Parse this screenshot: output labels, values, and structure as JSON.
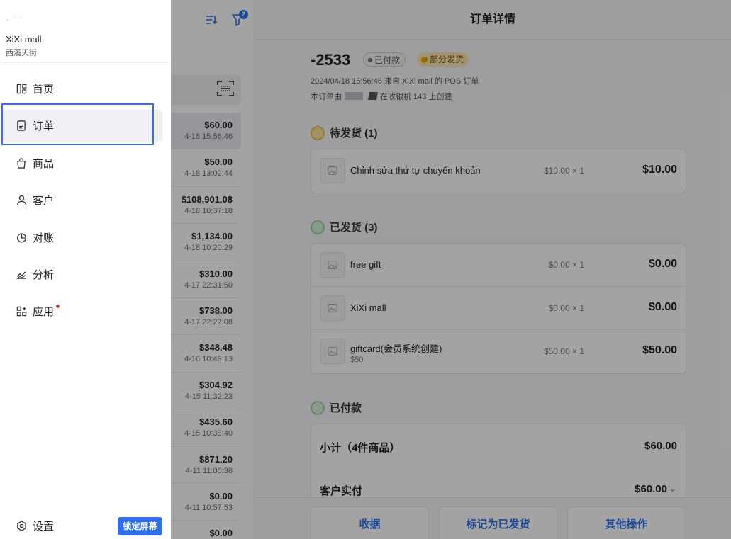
{
  "drawer": {
    "store_name": "XiXi mall",
    "store_sub": "西溪天街",
    "nav": [
      {
        "label": "首页",
        "icon": "home-icon"
      },
      {
        "label": "订单",
        "icon": "order-icon",
        "active": true
      },
      {
        "label": "商品",
        "icon": "bag-icon"
      },
      {
        "label": "客户",
        "icon": "user-icon"
      },
      {
        "label": "对账",
        "icon": "pie-icon"
      },
      {
        "label": "分析",
        "icon": "analytics-icon"
      },
      {
        "label": "应用",
        "icon": "apps-icon",
        "dot": true
      }
    ],
    "settings_label": "设置",
    "lock_label": "锁定屏幕"
  },
  "list": {
    "filter_badge": "2",
    "orders": [
      {
        "amount": "$60.00",
        "date": "4-18 15:56:46"
      },
      {
        "amount": "$50.00",
        "date": "4-18 13:02:44"
      },
      {
        "amount": "$108,901.08",
        "date": "4-18 10:37:18"
      },
      {
        "amount": "$1,134.00",
        "date": "4-18 10:20:29"
      },
      {
        "amount": "$310.00",
        "date": "4-17 22:31:50"
      },
      {
        "amount": "$738.00",
        "date": "4-17 22:27:08"
      },
      {
        "amount": "$348.48",
        "date": "4-16 10:49:13"
      },
      {
        "amount": "$304.92",
        "date": "4-15 11:32:23"
      },
      {
        "amount": "$435.60",
        "date": "4-15 10:38:40"
      },
      {
        "amount": "$871.20",
        "date": "4-11 11:00:38"
      },
      {
        "amount": "$0.00",
        "date": "4-11 10:57:53"
      },
      {
        "amount": "$0.00",
        "date": ""
      }
    ]
  },
  "detail": {
    "header_title": "订单详情",
    "order_number": "-2533",
    "status_paid": "已付款",
    "status_partial": "部分发货",
    "meta_line1": "2024/04/18 15:56:46 来自 XiXi mall 的 POS 订单",
    "meta_line2_a": "本订单由",
    "meta_line2_b": "在收银机  143  上创建",
    "pending": {
      "title": "待发货 (1)",
      "items": [
        {
          "name": "Chỉnh sửa thứ tự chuyển khoản",
          "sub": "",
          "qty": "$10.00 × 1",
          "amount": "$10.00"
        }
      ]
    },
    "shipped": {
      "title": "已发货 (3)",
      "items": [
        {
          "name": "free gift",
          "sub": "",
          "qty": "$0.00 × 1",
          "amount": "$0.00"
        },
        {
          "name": "XiXi mall",
          "sub": "",
          "qty": "$0.00 × 1",
          "amount": "$0.00"
        },
        {
          "name": "giftcard(会员系统创建)",
          "sub": "$50",
          "qty": "$50.00 × 1",
          "amount": "$50.00"
        }
      ]
    },
    "paid": {
      "title": "已付款",
      "subtotal_label": "小计（4件商品）",
      "subtotal_value": "$60.00",
      "customer_paid_label": "客户实付",
      "customer_paid_value": "$60.00"
    },
    "footer": {
      "receipt": "收据",
      "mark_shipped": "标记为已发货",
      "more": "其他操作"
    }
  }
}
